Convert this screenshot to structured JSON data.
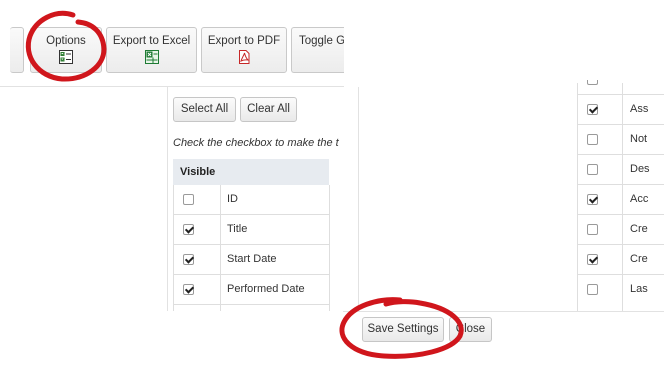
{
  "toolbar": {
    "options_label": "Options",
    "export_excel_label": "Export to Excel",
    "export_pdf_label": "Export to PDF",
    "toggle_label": "Toggle G"
  },
  "left_panel": {
    "select_all": "Select All",
    "clear_all": "Clear All",
    "instruction": "Check the checkbox to make the t",
    "header_visible": "Visible",
    "rows": [
      {
        "label": "ID",
        "checked": false
      },
      {
        "label": "Title",
        "checked": true
      },
      {
        "label": "Start Date",
        "checked": true
      },
      {
        "label": "Performed Date",
        "checked": true
      }
    ]
  },
  "right_panel": {
    "rows": [
      {
        "label": "Ass",
        "checked": true
      },
      {
        "label": "Not",
        "checked": false
      },
      {
        "label": "Des",
        "checked": false
      },
      {
        "label": "Acc",
        "checked": true
      },
      {
        "label": "Cre",
        "checked": false
      },
      {
        "label": "Cre",
        "checked": true
      },
      {
        "label": "Las",
        "checked": false
      }
    ]
  },
  "footer": {
    "save_settings": "Save Settings",
    "close": "Close"
  },
  "annotation_color": "#d0161c"
}
